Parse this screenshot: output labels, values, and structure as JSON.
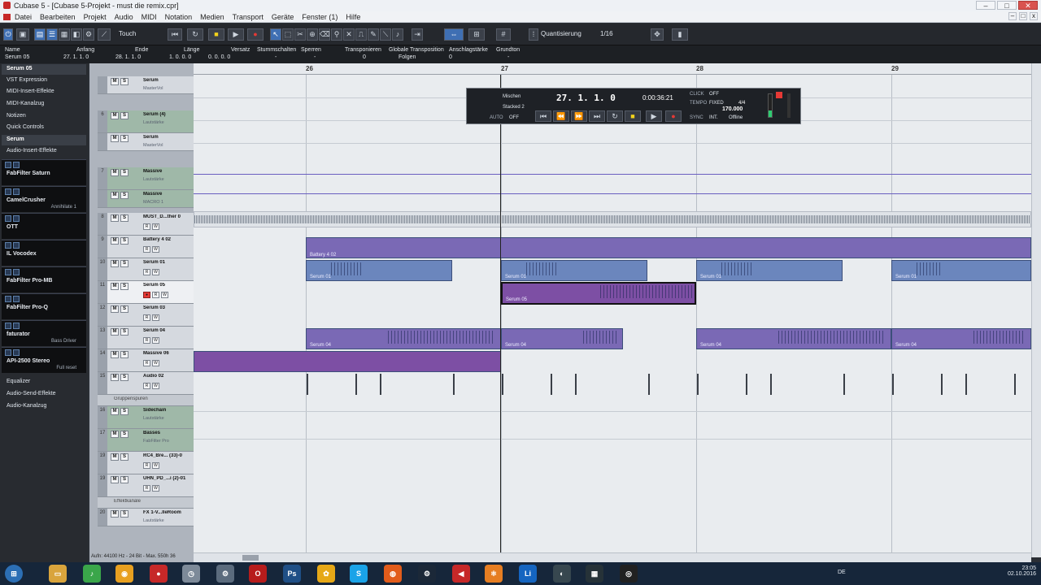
{
  "window": {
    "title": "Cubase 5 - [Cubase 5-Projekt - must die remix.cpr]"
  },
  "menu": [
    "Datei",
    "Bearbeiten",
    "Projekt",
    "Audio",
    "MIDI",
    "Notation",
    "Medien",
    "Transport",
    "Geräte",
    "Fenster (1)",
    "Hilfe"
  ],
  "toolbar": {
    "automation_mode": "Touch",
    "quantize_label": "Quantisierung",
    "quantize_value": "1/16"
  },
  "infoline": {
    "name_label": "Name",
    "name_value": "Serum 05",
    "start_label": "Anfang",
    "start_value": "27. 1. 1. 0",
    "end_label": "Ende",
    "end_value": "28. 1. 1. 0",
    "length_label": "Länge",
    "length_value": "1. 0. 0. 0",
    "offset_label": "Versatz",
    "offset_value": "0. 0. 0. 0",
    "mute_label": "Stummschalten",
    "mute_value": "-",
    "lock_label": "Sperren",
    "lock_value": "-",
    "transpose_label": "Transponieren",
    "transpose_value": "0",
    "global_label": "Globale Transposition",
    "global_value": "Folgen",
    "velocity_label": "Anschlagstärke",
    "velocity_value": "0",
    "root_label": "Grundton",
    "root_value": "-"
  },
  "inspector": {
    "track_name": "Serum 05",
    "sections": [
      "VST Expression",
      "MIDI-Insert-Effekte",
      "MIDI-Kanalzug",
      "Notizen",
      "Quick Controls"
    ],
    "instrument_name": "Serum",
    "audio_insert_label": "Audio-Insert-Effekte",
    "plugins": [
      {
        "name": "FabFilter Saturn",
        "sub": ""
      },
      {
        "name": "CamelCrusher",
        "sub": "Annihilate 1"
      },
      {
        "name": "OTT",
        "sub": ""
      },
      {
        "name": "IL Vocodex",
        "sub": ""
      },
      {
        "name": "FabFilter Pro-MB",
        "sub": ""
      },
      {
        "name": "FabFilter Pro-Q",
        "sub": ""
      },
      {
        "name": "faturator",
        "sub": "Bass Driver"
      },
      {
        "name": "API-2500 Stereo",
        "sub": "Full reset"
      }
    ],
    "footer": [
      "Equalizer",
      "Audio-Send-Effekte",
      "Audio-Kanalzug"
    ]
  },
  "tracks": [
    {
      "num": "",
      "name": "Serum",
      "sub": "MasterVol"
    },
    {
      "num": "6",
      "name": "Serum (4)",
      "sub": "Lautstärke"
    },
    {
      "num": "",
      "name": "Serum",
      "sub": "MasterVol"
    },
    {
      "num": "7",
      "name": "Massive",
      "sub": "Lautstärke"
    },
    {
      "num": "",
      "name": "Massive",
      "sub": "MACRO 1"
    },
    {
      "num": "8",
      "name": "MUST_D...ther 0",
      "sub": ""
    },
    {
      "num": "9",
      "name": "Battery 4 02",
      "sub": ""
    },
    {
      "num": "10",
      "name": "Serum 01",
      "sub": ""
    },
    {
      "num": "11",
      "name": "Serum 05",
      "sub": ""
    },
    {
      "num": "12",
      "name": "Serum 03",
      "sub": ""
    },
    {
      "num": "13",
      "name": "Serum 04",
      "sub": ""
    },
    {
      "num": "14",
      "name": "Massive 06",
      "sub": ""
    },
    {
      "num": "15",
      "name": "Audio 02",
      "sub": ""
    },
    {
      "num": "",
      "name": "Gruppenspuren",
      "sub": ""
    },
    {
      "num": "16",
      "name": "Sidechain",
      "sub": "Lautstärke"
    },
    {
      "num": "17",
      "name": "Basses",
      "sub": "FabFilter Pro"
    },
    {
      "num": "19",
      "name": "RC4_Bre... (33)-0",
      "sub": ""
    },
    {
      "num": "19",
      "name": "UHN_PD_...i (2)-01",
      "sub": ""
    },
    {
      "num": "",
      "name": "Effektkanäle",
      "sub": ""
    },
    {
      "num": "20",
      "name": "FX 1-V...lleRoom",
      "sub": "Lautstärke"
    }
  ],
  "ruler": {
    "bars": [
      "26",
      "27",
      "28",
      "29"
    ]
  },
  "events": [
    {
      "label": "Battery 4 02"
    },
    {
      "label": "Serum 01"
    },
    {
      "label": "Serum 01"
    },
    {
      "label": "Serum 01"
    },
    {
      "label": "Serum 01"
    },
    {
      "label": "Serum 05"
    },
    {
      "label": "Serum 04"
    },
    {
      "label": "Serum 04"
    },
    {
      "label": "Serum 04"
    },
    {
      "label": "Serum 04"
    }
  ],
  "transport": {
    "position_bars": "27. 1. 1.   0",
    "position_time": "0:00:36:21",
    "mix_label": "Mischen",
    "stack_label": "Stacked 2",
    "auto_label": "AUTO",
    "auto_value": "OFF",
    "click_label": "CLICK",
    "click_value": "OFF",
    "tempo_label": "TEMPO",
    "tempo_mode": "FIXED",
    "signature": "4/4",
    "tempo_value": "170.000",
    "sync_label": "SYNC",
    "sync_mode": "INT.",
    "sync_value": "Offline"
  },
  "status": "Aufn: 44100 Hz - 24 Bit - Max. 550h 36",
  "taskbar": {
    "apps": [
      "Start",
      "Explorer",
      "FL",
      "Chrome",
      "Rec",
      "Clock",
      "Steam2",
      "Opera",
      "Ps",
      "Fl2",
      "Skype",
      "Firefox",
      "Steam",
      "Cubase",
      "Blender",
      "Live",
      "Edge",
      "Film",
      "OBS"
    ],
    "lang": "DE",
    "time": "23:05",
    "date": "02.10.2016"
  },
  "colors": {
    "toolbar_bg": "#25282d",
    "event_blue": "#6b86bd",
    "event_purple": "#7a69b5",
    "record": "#e53935"
  }
}
